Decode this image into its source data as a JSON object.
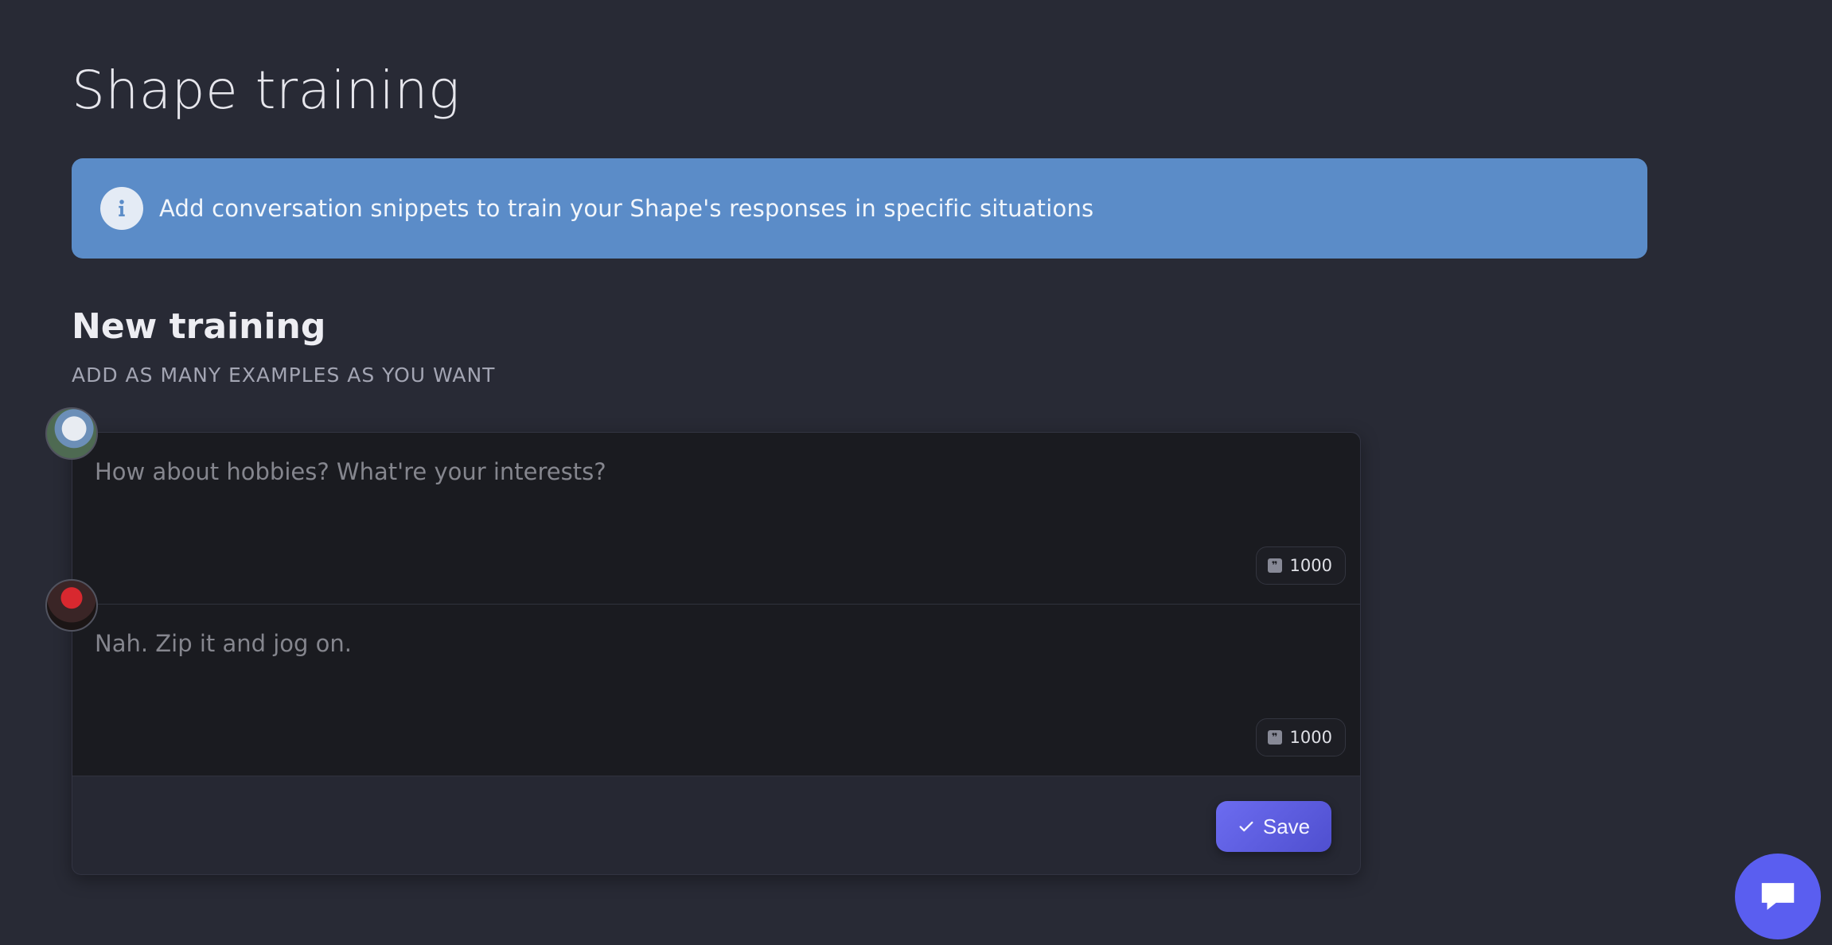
{
  "page": {
    "title": "Shape training"
  },
  "banner": {
    "icon": "info-icon",
    "text": "Add conversation snippets to train your Shape's responses in specific situations",
    "color": "#5b8cc8"
  },
  "section": {
    "title": "New training",
    "subtitle": "ADD AS MANY EXAMPLES AS YOU WANT"
  },
  "messages": [
    {
      "role": "user",
      "placeholder": "How about hobbies? What're your interests?",
      "counter": "1000",
      "avatar": "user-avatar"
    },
    {
      "role": "shape",
      "placeholder": "Nah. Zip it and jog on.",
      "counter": "1000",
      "avatar": "shape-avatar"
    }
  ],
  "actions": {
    "save_label": "Save",
    "save_icon": "check-icon",
    "accent": "#5b5bdf"
  },
  "chat_widget": {
    "icon": "chat-bubble-icon",
    "color": "#5a5ef0"
  }
}
